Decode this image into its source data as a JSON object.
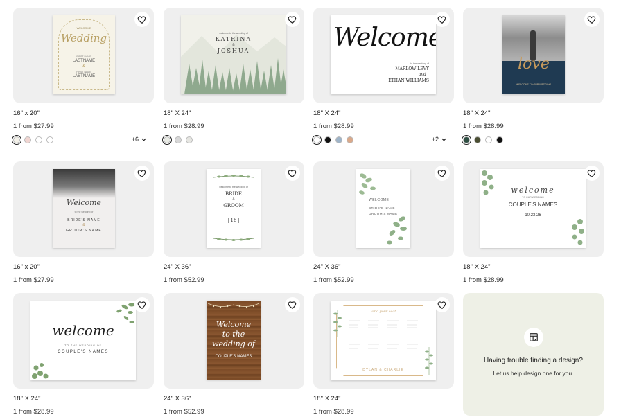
{
  "products": [
    {
      "size": "16\" x 20\"",
      "price": "1 from $27.99",
      "more": "+6",
      "swatches": [
        "#f3f1e9",
        "#f1d6d2",
        "#ffffff",
        "#ffffff"
      ],
      "art": {
        "l1": "WELCOME",
        "l2": "Wedding",
        "l3": "FIRST NAME",
        "l4": "LASTNAME",
        "l5": "&",
        "l6": "FIRST NAME",
        "l7": "LASTNAME"
      }
    },
    {
      "size": "18\" X 24\"",
      "price": "1 from $28.99",
      "more": "",
      "swatches": [
        "#e9ebe5",
        "#d8d8d8",
        "#e6e6e2"
      ],
      "art": {
        "l1": "welcome to the wedding of",
        "l2": "KATRINA",
        "l3": "&",
        "l4": "JOSHUA"
      }
    },
    {
      "size": "18\" X 24\"",
      "price": "1 from $28.99",
      "more": "+2",
      "swatches": [
        "#ffffff",
        "#111111",
        "#9fb4c8",
        "#d9a98b"
      ],
      "art": {
        "l1": "Welcome",
        "l2": "to the wedding of",
        "l3": "MARLOW LEVY",
        "l4": "and",
        "l5": "ETHAN WILLIAMS"
      }
    },
    {
      "size": "18\" X 24\"",
      "price": "1 from $28.99",
      "more": "",
      "swatches": [
        "#2f4f43",
        "#4b4f34",
        "#ffffff",
        "#111111"
      ],
      "art": {
        "l1": "love",
        "l2": "WELCOME TO OUR WEDDING"
      }
    },
    {
      "size": "16\" x 20\"",
      "price": "1 from $27.99",
      "more": "",
      "swatches": [],
      "art": {
        "l1": "Welcome",
        "l2": "to the wedding of",
        "l3": "BRIDE'S NAME",
        "l4": "&",
        "l5": "GROOM'S NAME"
      }
    },
    {
      "size": "24\" X 36\"",
      "price": "1 from $52.99",
      "more": "",
      "swatches": [],
      "art": {
        "l1": "welcome to the wedding of",
        "l2": "BRIDE",
        "l3": "&",
        "l4": "GROOM",
        "l5": "18"
      }
    },
    {
      "size": "24\" X 36\"",
      "price": "1 from $52.99",
      "more": "",
      "swatches": [],
      "art": {
        "l1": "WELCOME",
        "l2": "BRIDE'S NAME",
        "l3": "GROOM'S NAME"
      }
    },
    {
      "size": "18\" X 24\"",
      "price": "1 from $28.99",
      "more": "",
      "swatches": [],
      "art": {
        "l1": "welcome",
        "l2": "TO OUR WEDDING",
        "l3": "COUPLE'S NAMES",
        "l4": "10.23.26"
      }
    },
    {
      "size": "18\" X 24\"",
      "price": "1 from $28.99",
      "more": "",
      "swatches": [],
      "art": {
        "l1": "welcome",
        "l2": "TO THE WEDDING OF",
        "l3": "COUPLE'S NAMES"
      }
    },
    {
      "size": "24\" X 36\"",
      "price": "1 from $52.99",
      "more": "",
      "swatches": [],
      "art": {
        "l1": "Welcome",
        "l2": "to the",
        "l3": "wedding of",
        "l4": "COUPLE'S NAMES"
      }
    },
    {
      "size": "18\" X 24\"",
      "price": "1 from $28.99",
      "more": "",
      "swatches": [],
      "art": {
        "l1": "Find your seat",
        "l2": "DYLAN & CHARLIE"
      }
    }
  ],
  "help": {
    "title": "Having trouble finding a design?",
    "subtitle": "Let us help design one for you.",
    "icon": "design-request-icon"
  },
  "icons": {
    "favorite": "heart-icon",
    "expand": "chevron-down-icon"
  }
}
